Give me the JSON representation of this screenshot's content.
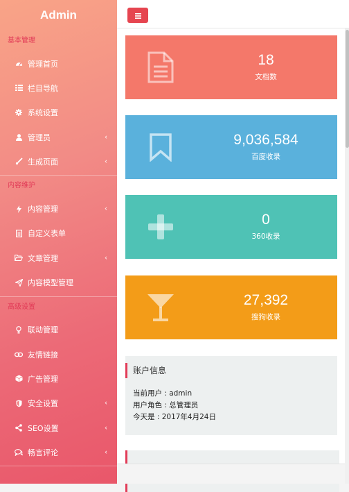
{
  "brand": "Admin",
  "sidebar": {
    "sections": [
      {
        "title": "基本管理",
        "items": [
          {
            "label": "管理首页",
            "icon": "dashboard-icon",
            "chevron": false
          },
          {
            "label": "栏目导航",
            "icon": "list-icon",
            "chevron": false
          },
          {
            "label": "系统设置",
            "icon": "gear-icon",
            "chevron": false
          },
          {
            "label": "管理员",
            "icon": "user-icon",
            "chevron": true
          },
          {
            "label": "生成页面",
            "icon": "brush-icon",
            "chevron": true
          }
        ]
      },
      {
        "title": "内容维护",
        "items": [
          {
            "label": "内容管理",
            "icon": "bolt-icon",
            "chevron": true
          },
          {
            "label": "自定义表单",
            "icon": "form-icon",
            "chevron": false
          },
          {
            "label": "文章管理",
            "icon": "folder-open-icon",
            "chevron": true
          },
          {
            "label": "内容模型管理",
            "icon": "send-icon",
            "chevron": false
          }
        ]
      },
      {
        "title": "高级设置",
        "items": [
          {
            "label": "联动管理",
            "icon": "bulb-icon",
            "chevron": false
          },
          {
            "label": "友情链接",
            "icon": "link-icon",
            "chevron": false
          },
          {
            "label": "广告管理",
            "icon": "cube-icon",
            "chevron": false
          },
          {
            "label": "安全设置",
            "icon": "shield-icon",
            "chevron": true
          },
          {
            "label": "SEO设置",
            "icon": "share-icon",
            "chevron": true
          },
          {
            "label": "畅言评论",
            "icon": "comments-icon",
            "chevron": true
          }
        ]
      }
    ]
  },
  "topbar": {
    "menu_icon": "hamburger-icon",
    "accent": "#e64550"
  },
  "stats": [
    {
      "value": "18",
      "label": "文档数",
      "icon": "document-icon",
      "color": "#f4786a"
    },
    {
      "value": "9,036,584",
      "label": "百度收录",
      "icon": "bookmark-icon",
      "color": "#5ab1dc"
    },
    {
      "value": "0",
      "label": "360收录",
      "icon": "plus-icon",
      "color": "#4fc2b5"
    },
    {
      "value": "27,392",
      "label": "搜狗收录",
      "icon": "cocktail-icon",
      "color": "#f39c18"
    }
  ],
  "account": {
    "title": "账户信息",
    "lines": [
      "当前用户 : admin",
      "用户角色 : 总管理员",
      "今天是 : 2017年4月24日"
    ]
  }
}
